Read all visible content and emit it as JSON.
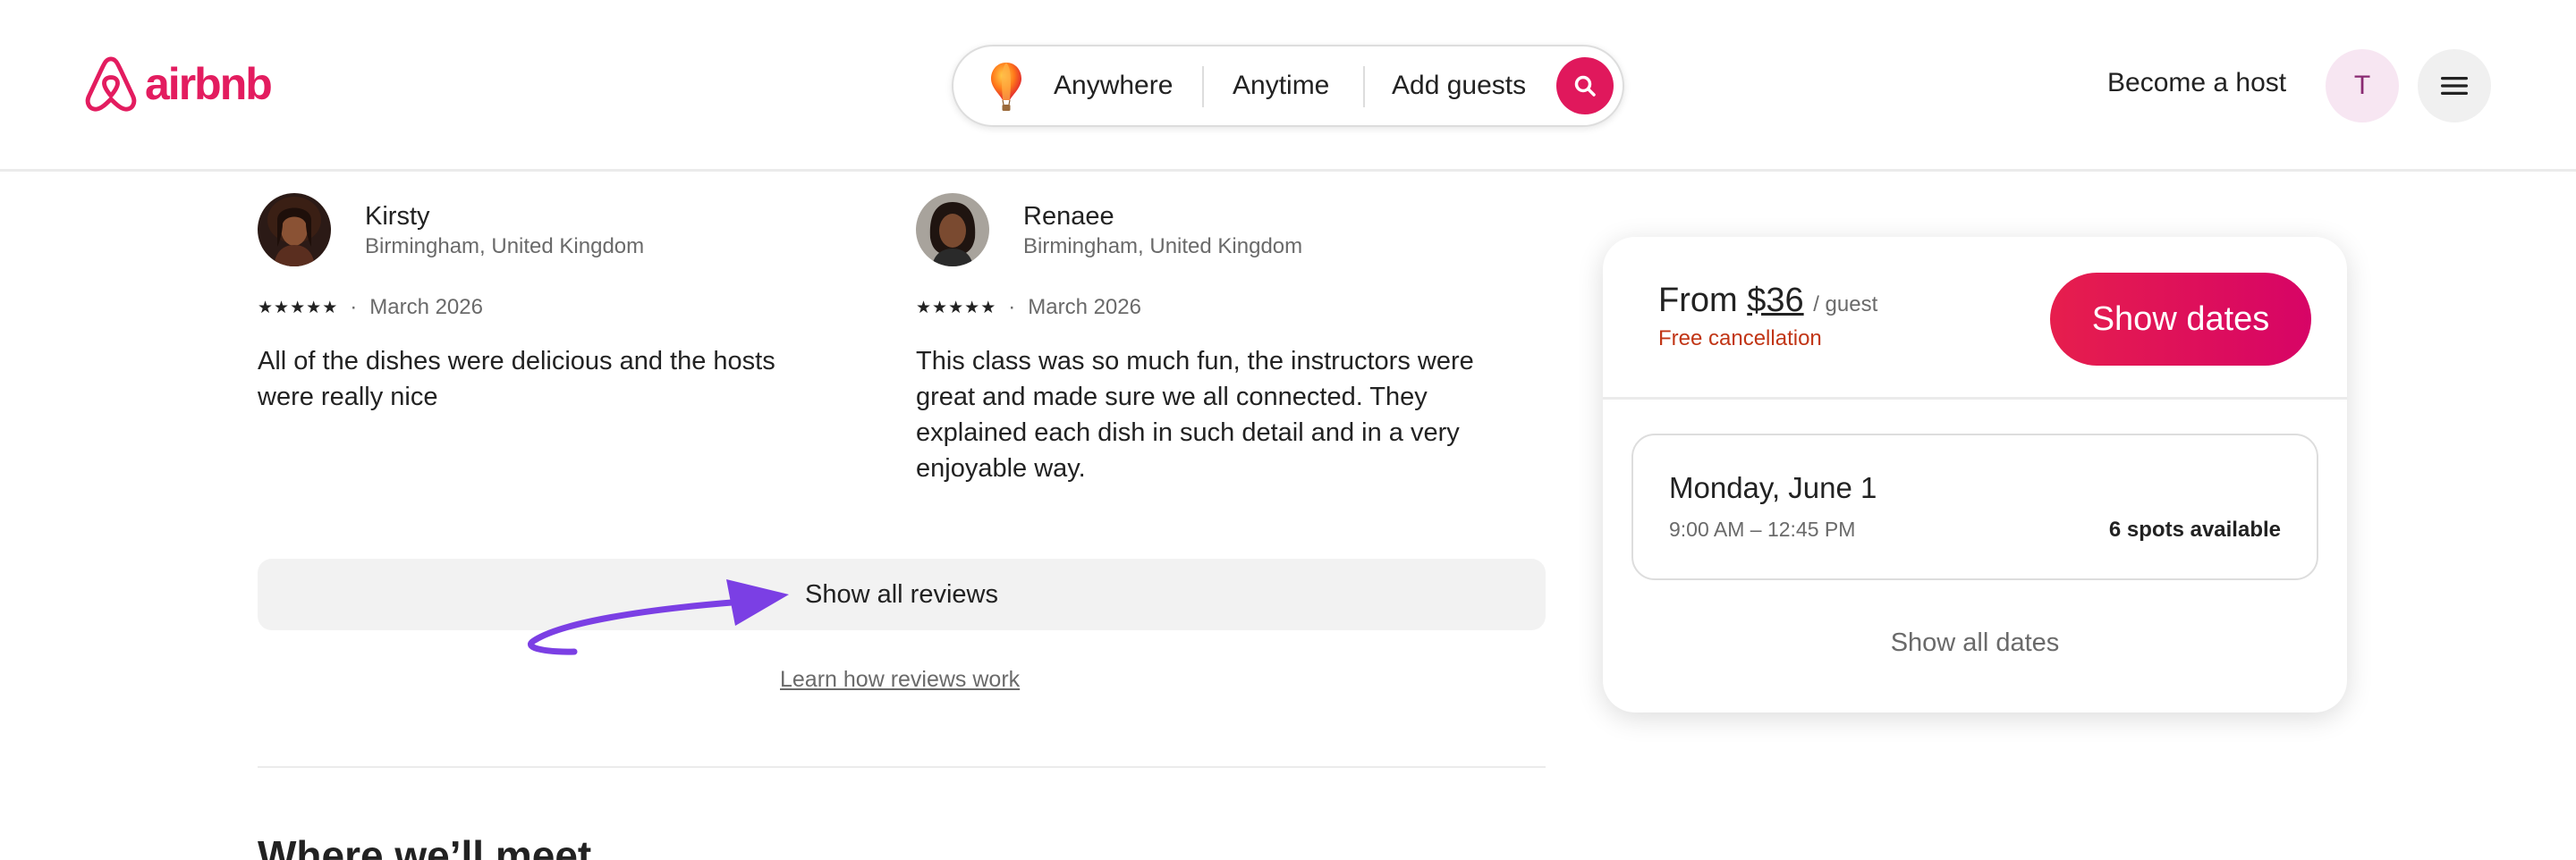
{
  "header": {
    "logo_text": "airbnb",
    "search": {
      "anywhere": "Anywhere",
      "anytime": "Anytime",
      "guests": "Add guests"
    },
    "become_host": "Become a host",
    "avatar_initial": "T"
  },
  "reviews": [
    {
      "name": "Kirsty",
      "location": "Birmingham, United Kingdom",
      "rating": 5,
      "date": "March 2026",
      "text": "All of the dishes were delicious and the hosts were really nice"
    },
    {
      "name": "Renaee",
      "location": "Birmingham, United Kingdom",
      "rating": 5,
      "date": "March 2026",
      "text": "This class was so much fun, the instructors were great and made sure we all connected. They explained each dish in such detail and in a very enjoyable way."
    }
  ],
  "show_all_reviews": "Show all reviews",
  "learn_reviews": "Learn how reviews work",
  "section_title": "Where we’ll meet",
  "booking": {
    "price_prefix": "From",
    "price": "$36",
    "price_unit": "/ guest",
    "free_cancellation": "Free cancellation",
    "show_dates": "Show dates",
    "date_option": {
      "title": "Monday, June 1",
      "time": "9:00 AM – 12:45 PM",
      "spots": "6 spots available"
    },
    "show_all_dates": "Show all dates"
  },
  "colors": {
    "brand": "#e31c5f",
    "annotation_arrow": "#7b3fe4"
  },
  "icons": {
    "logo": "airbnb-logo-icon",
    "balloon": "hot-air-balloon-icon",
    "search": "search-icon",
    "menu": "hamburger-menu-icon",
    "star": "star-icon",
    "arrow": "annotation-arrow-icon"
  }
}
